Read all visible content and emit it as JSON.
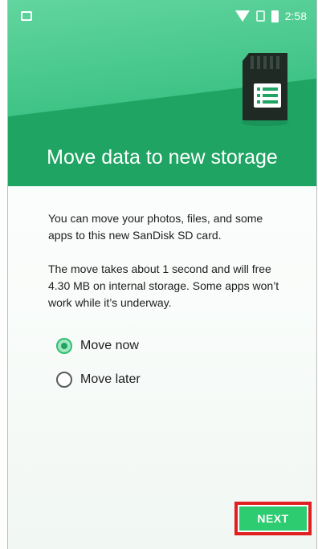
{
  "status_bar": {
    "time": "2:58",
    "icons": [
      "image-notification-icon",
      "wifi-icon",
      "no-sim-icon",
      "battery-icon"
    ]
  },
  "hero": {
    "title": "Move data to new storage",
    "illustration": "sd-card-icon"
  },
  "body": {
    "paragraph1": "You can move your photos, files, and some apps to this new SanDisk SD card.",
    "paragraph2": "The move takes about 1 second and will free 4.30 MB on internal storage. Some apps won’t work while it’s underway."
  },
  "options": [
    {
      "label": "Move now",
      "selected": true
    },
    {
      "label": "Move later",
      "selected": false
    }
  ],
  "actions": {
    "next_label": "NEXT"
  },
  "colors": {
    "accent": "#1fa463",
    "accent_light": "#63d6a0",
    "button": "#2ecc71",
    "highlight_box": "#e02020"
  }
}
